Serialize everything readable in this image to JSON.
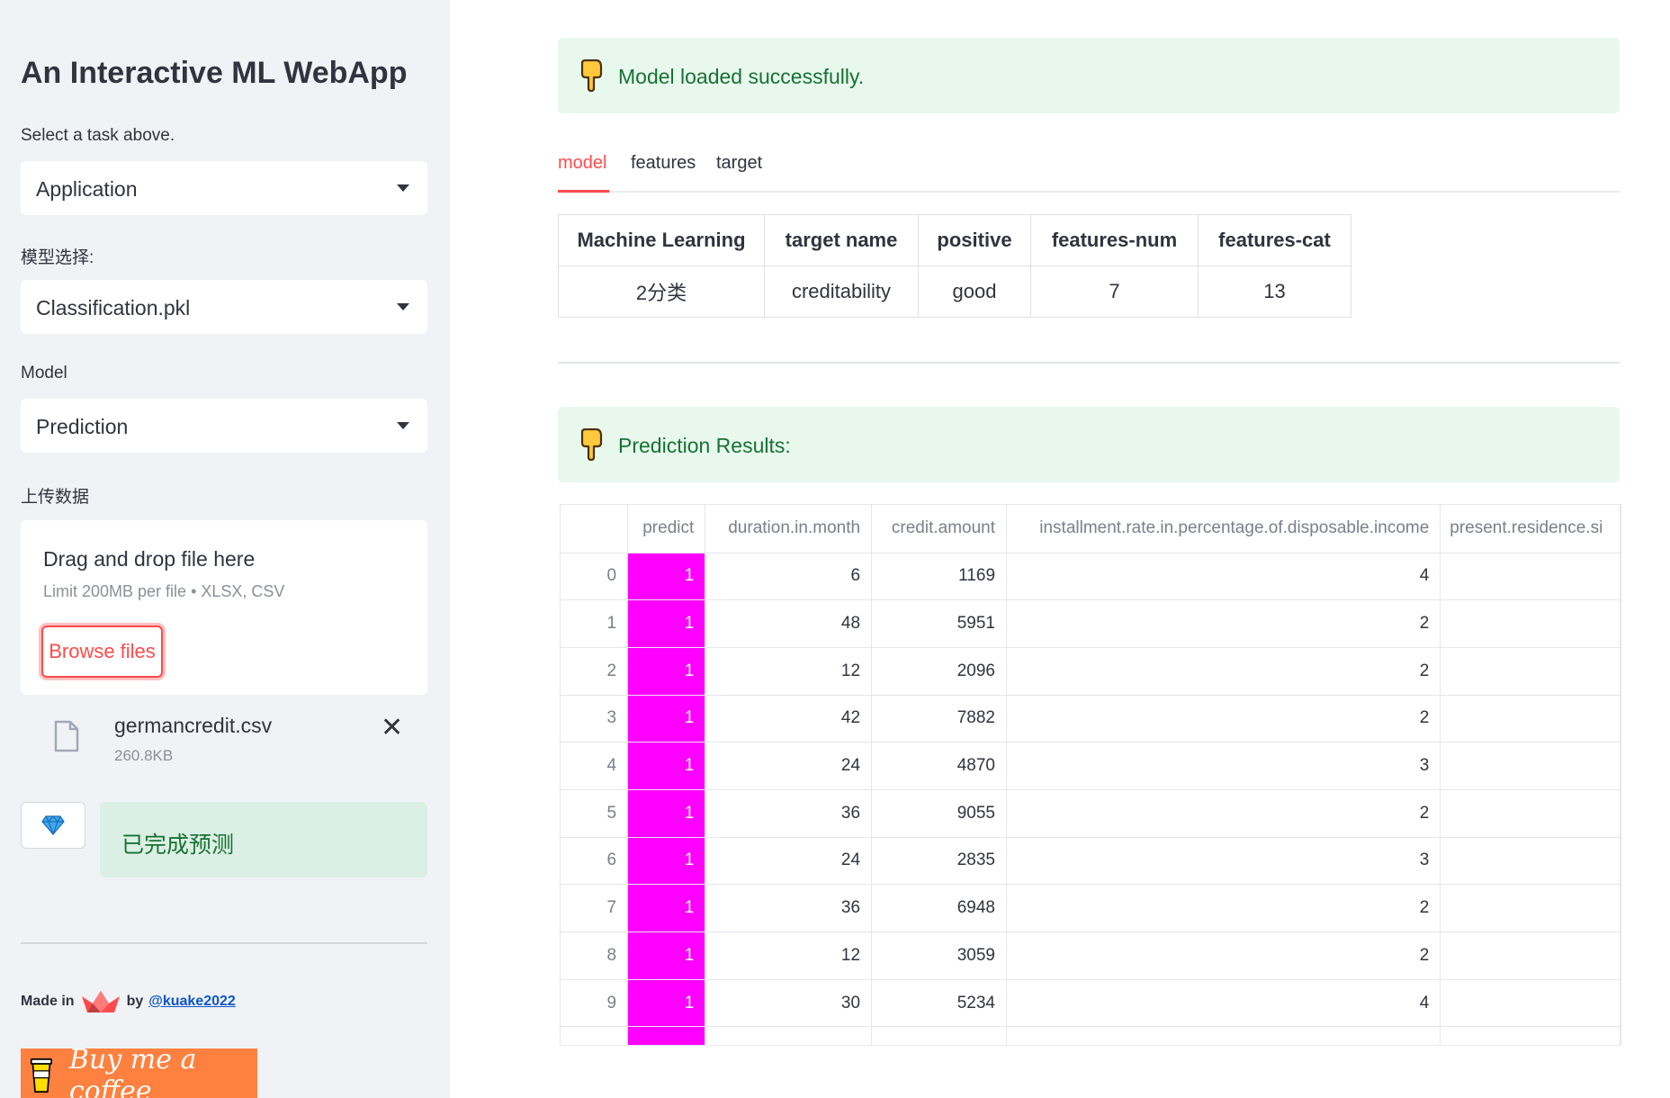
{
  "sidebar": {
    "title": "An Interactive ML WebApp",
    "task_label": "Select a task above.",
    "task_value": "Application",
    "model_select_label": "模型选择:",
    "model_select_value": "Classification.pkl",
    "mode_label": "Model",
    "mode_value": "Prediction",
    "upload_label": "上传数据",
    "upload": {
      "drag_text": "Drag and drop file here",
      "limit_text": "Limit 200MB per file • XLSX, CSV",
      "browse_label": "Browse files"
    },
    "file": {
      "name": "germancredit.csv",
      "size": "260.8KB"
    },
    "done_text": "已完成预测",
    "footer": {
      "made_in": "Made in",
      "by": "by",
      "author": "@kuake2022"
    },
    "coffee_label": "Buy me a coffee"
  },
  "main": {
    "alert_loaded": "Model loaded successfully.",
    "tabs": [
      {
        "label": "model",
        "active": true
      },
      {
        "label": "features",
        "active": false
      },
      {
        "label": "target",
        "active": false
      }
    ],
    "info_table": {
      "headers": [
        "Machine Learning",
        "target name",
        "positive",
        "features-num",
        "features-cat"
      ],
      "row": [
        "2分类",
        "creditability",
        "good",
        "7",
        "13"
      ]
    },
    "alert_results": "Prediction Results:",
    "results": {
      "columns": [
        "",
        "predict",
        "duration.in.month",
        "credit.amount",
        "installment.rate.in.percentage.of.disposable.income",
        "present.residence.si"
      ],
      "rows": [
        [
          "0",
          "1",
          "6",
          "1169",
          "4"
        ],
        [
          "1",
          "1",
          "48",
          "5951",
          "2"
        ],
        [
          "2",
          "1",
          "12",
          "2096",
          "2"
        ],
        [
          "3",
          "1",
          "42",
          "7882",
          "2"
        ],
        [
          "4",
          "1",
          "24",
          "4870",
          "3"
        ],
        [
          "5",
          "1",
          "36",
          "9055",
          "2"
        ],
        [
          "6",
          "1",
          "24",
          "2835",
          "3"
        ],
        [
          "7",
          "1",
          "36",
          "6948",
          "2"
        ],
        [
          "8",
          "1",
          "12",
          "3059",
          "2"
        ],
        [
          "9",
          "1",
          "30",
          "5234",
          "4"
        ]
      ],
      "highlight_color": "#ff00ff"
    }
  },
  "colors": {
    "accent": "#ff4b4b",
    "success_bg": "#e8f8ed",
    "success_text": "#177233",
    "sidebar_bg": "#f0f2f6"
  }
}
